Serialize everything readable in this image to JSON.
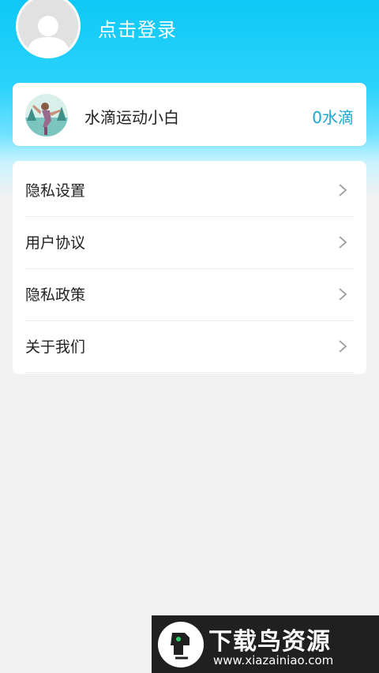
{
  "profile": {
    "login_label": "点击登录"
  },
  "level_card": {
    "title": "水滴运动小白",
    "drops": "0水滴"
  },
  "menu": {
    "items": [
      {
        "label": "隐私设置"
      },
      {
        "label": "用户协议"
      },
      {
        "label": "隐私政策"
      },
      {
        "label": "关于我们"
      }
    ]
  },
  "watermark": {
    "title": "下载鸟资源",
    "url": "www.xiazainiao.com"
  },
  "colors": {
    "header": "#0fc8f6",
    "accent": "#18a8d8",
    "background": "#f1f1f1"
  },
  "icons": [
    "avatar-icon",
    "chevron-right-icon",
    "level-badge-icon",
    "logo-icon"
  ]
}
